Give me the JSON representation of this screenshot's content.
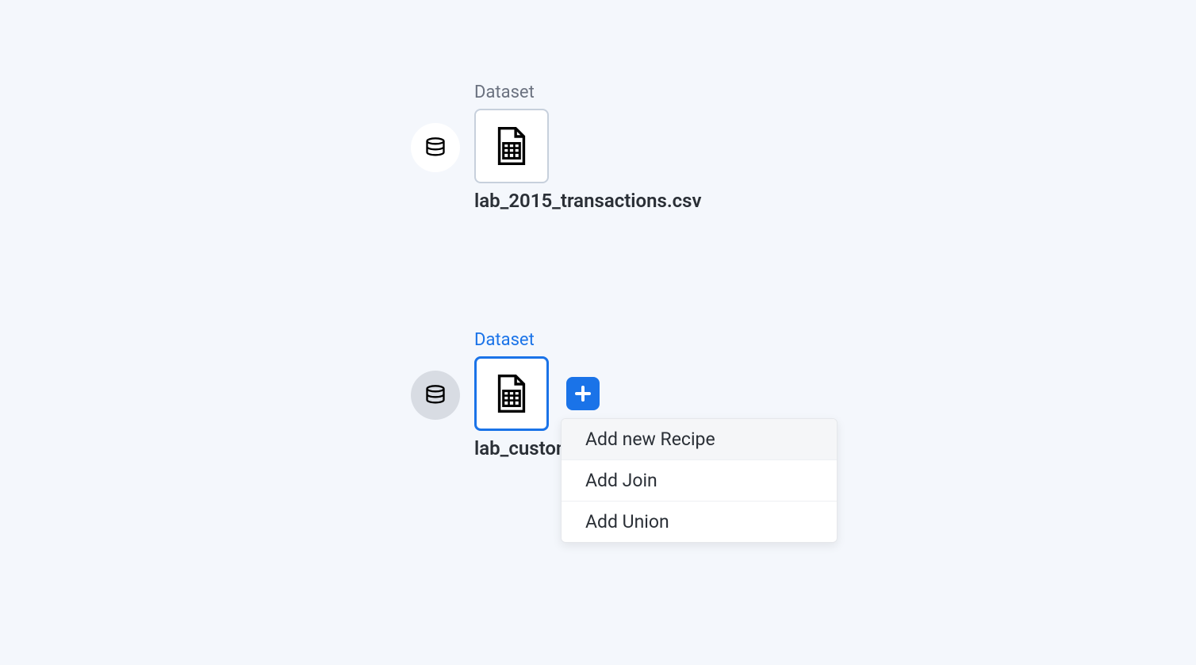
{
  "nodes": {
    "first": {
      "type_label": "Dataset",
      "title": "lab_2015_transactions.csv"
    },
    "second": {
      "type_label": "Dataset",
      "title": "lab_customers.csv"
    }
  },
  "menu": {
    "items": [
      "Add new Recipe",
      "Add Join",
      "Add Union"
    ]
  }
}
